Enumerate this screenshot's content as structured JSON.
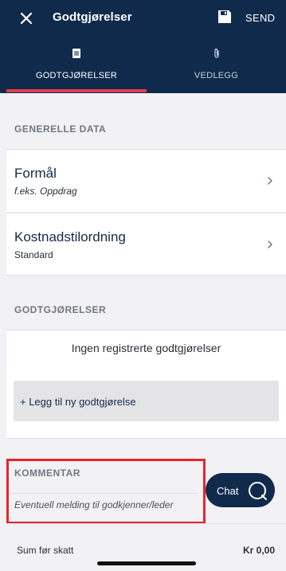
{
  "header": {
    "title": "Godtgjørelser",
    "close_icon": "close-icon",
    "save_icon": "save-icon",
    "send_label": "SEND",
    "background": "#102a4c"
  },
  "tabs": [
    {
      "label": "GODTGJØRELSER",
      "icon": "document-icon",
      "active": true
    },
    {
      "label": "VEDLEGG",
      "icon": "paperclip-icon",
      "active": false
    }
  ],
  "accent_color": "#e03a4f",
  "general": {
    "heading": "GENERELLE DATA",
    "items": [
      {
        "title": "Formål",
        "subtitle": "f.eks. Oppdrag"
      },
      {
        "title": "Kostnadstilordning",
        "subtitle": "Standard"
      }
    ]
  },
  "allowances": {
    "heading": "GODTGJØRELSER",
    "empty_text": "Ingen registrerte godtgjørelser",
    "add_label": "+ Legg til ny godtgjørelse"
  },
  "comment": {
    "heading": "KOMMENTAR",
    "placeholder": "Eventuell melding til godkjenner/leder",
    "highlight_color": "#e8232f"
  },
  "chat": {
    "label": "Chat",
    "icon": "chat-bubble-icon"
  },
  "footer": {
    "sum_label": "Sum før skatt",
    "sum_value": "Kr 0,00"
  }
}
